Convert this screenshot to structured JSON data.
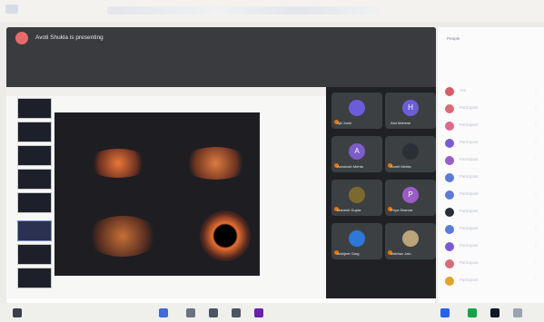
{
  "window": {
    "tab_label": "",
    "url_label": ""
  },
  "meet": {
    "presenting_text": "Avoti Shukla is presenting",
    "participant_tiles": [
      {
        "name": "Ajit Joshi",
        "initial": "",
        "avatar_color": "#6b5cd7",
        "mic_off": true
      },
      {
        "name": "Atul Mahesh",
        "initial": "H",
        "avatar_color": "#6b5cd7",
        "mic_off": false
      },
      {
        "name": "Ashutosh Mehta",
        "initial": "A",
        "avatar_color": "#7c5cc8",
        "mic_off": true
      },
      {
        "name": "Sumit Mehta",
        "initial": "",
        "avatar_color": "#2b2f38",
        "mic_off": true
      },
      {
        "name": "Mahesh Gupta",
        "initial": "",
        "avatar_color": "#7a6a2f",
        "mic_off": true
      },
      {
        "name": "Priya Sharma",
        "initial": "P",
        "avatar_color": "#9a5cc6",
        "mic_off": true
      },
      {
        "name": "Abhijeet Garg",
        "initial": "",
        "avatar_color": "#2f77d8",
        "mic_off": true
      },
      {
        "name": "Vaibhav Jain",
        "initial": "",
        "avatar_color": "#bda37a",
        "mic_off": true
      }
    ],
    "bottom_controls": [
      {
        "name": "end-call-button",
        "color": "#e86a3a"
      },
      {
        "name": "present-button",
        "color": "#ef7b2c"
      }
    ]
  },
  "right_panel": {
    "header": "People",
    "items": [
      {
        "label": "You",
        "color": "#d85a6b"
      },
      {
        "label": "Participant",
        "color": "#d86a78"
      },
      {
        "label": "Participant",
        "color": "#e06a86"
      },
      {
        "label": "Participant",
        "color": "#7b5ad6"
      },
      {
        "label": "Participant",
        "color": "#9a5cc6"
      },
      {
        "label": "Participant",
        "color": "#5a7bd6"
      },
      {
        "label": "Participant",
        "color": "#5a7bd6"
      },
      {
        "label": "Participant",
        "color": "#2b2f38"
      },
      {
        "label": "Participant",
        "color": "#5a7bd6"
      },
      {
        "label": "Participant",
        "color": "#7b5ad6"
      },
      {
        "label": "Participant",
        "color": "#d86a78"
      },
      {
        "label": "Participant",
        "color": "#e0a42a"
      }
    ]
  }
}
